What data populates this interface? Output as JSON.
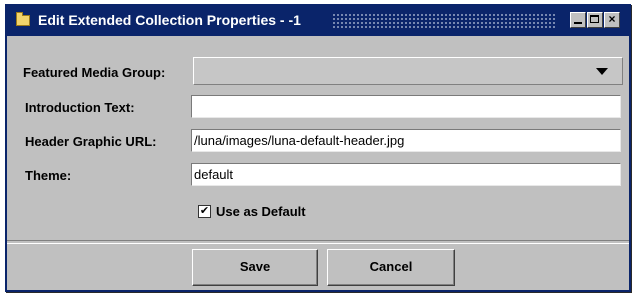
{
  "window": {
    "title": "Edit Extended Collection Properties - -1",
    "title_icon": "folder-icon",
    "controls": {
      "minimize": "minimize-icon",
      "maximize": "maximize-icon",
      "close": "×"
    }
  },
  "form": {
    "featured_media_group": {
      "label": "Featured Media Group:",
      "value": ""
    },
    "introduction_text": {
      "label": "Introduction Text:",
      "value": ""
    },
    "header_graphic_url": {
      "label": "Header Graphic URL:",
      "value": "/luna/images/luna-default-header.jpg"
    },
    "theme": {
      "label": "Theme:",
      "value": "default"
    },
    "use_as_default": {
      "label": "Use as Default",
      "checked": true,
      "check_glyph": "✔"
    }
  },
  "buttons": {
    "save": "Save",
    "cancel": "Cancel"
  },
  "colors": {
    "titlebar": "#0a246a",
    "window_bg": "#c0c0c0",
    "field_bg": "#ffffff"
  }
}
